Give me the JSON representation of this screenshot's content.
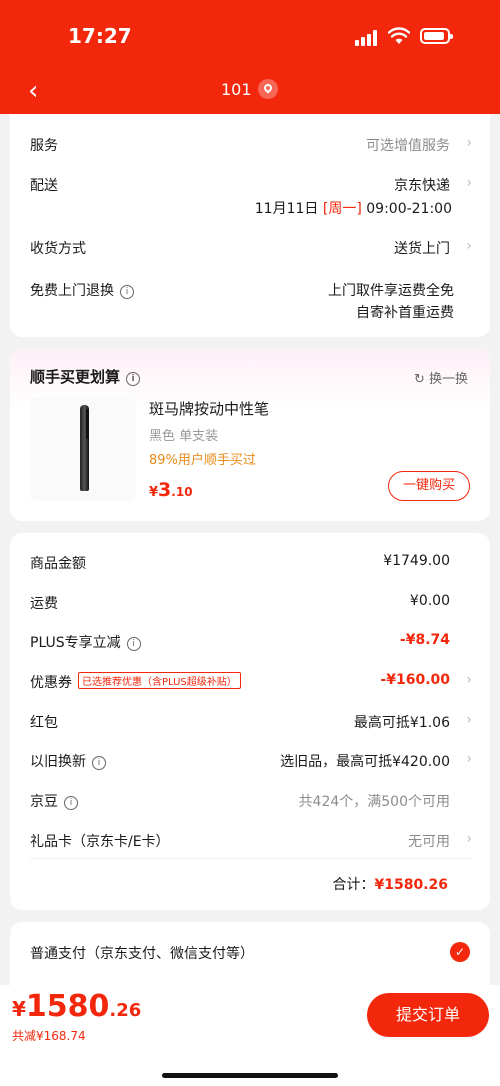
{
  "status": {
    "time": "17:27"
  },
  "nav": {
    "title": "101"
  },
  "delivery": {
    "service_label": "服务",
    "service_value": "可选增值服务",
    "ship_label": "配送",
    "ship_value": "京东快递",
    "ship_date": "11月11日",
    "ship_weekday": "[周一]",
    "ship_time": "09:00-21:00",
    "receive_label": "收货方式",
    "receive_value": "送货上门",
    "return_label": "免费上门退换",
    "return_value_1": "上门取件享运费全免",
    "return_value_2": "自寄补首重运费"
  },
  "addon": {
    "title": "顺手买更划算",
    "refresh_label": "换一换",
    "product_name": "斑马牌按动中性笔",
    "product_spec": "黑色 单支装",
    "product_promo": "89%用户顺手买过",
    "price_int": "3",
    "price_dec": ".10",
    "currency": "¥",
    "buy_label": "一键购买"
  },
  "summary": {
    "goods_label": "商品金额",
    "goods_value": "¥1749.00",
    "freight_label": "运费",
    "freight_value": "¥0.00",
    "plus_label": "PLUS专享立减",
    "plus_value": "-¥8.74",
    "coupon_label": "优惠券",
    "coupon_tag": "已选推荐优惠（含PLUS超级补贴）",
    "coupon_value": "-¥160.00",
    "redpack_label": "红包",
    "redpack_value": "最高可抵¥1.06",
    "tradein_label": "以旧换新",
    "tradein_value": "选旧品，最高可抵¥420.00",
    "bean_label": "京豆",
    "bean_value": "共424个，满500个可用",
    "giftcard_label": "礼品卡（京东卡/E卡）",
    "giftcard_value": "无可用",
    "total_label": "合计：",
    "total_value": "¥1580.26"
  },
  "payment": {
    "label": "普通支付（京东支付、微信支付等）"
  },
  "bottom": {
    "currency": "¥",
    "price_int": "1580",
    "price_dec": ".26",
    "saved": "共减¥168.74",
    "submit": "提交订单"
  },
  "colors": {
    "brand": "#f2270c",
    "bg": "#f2f2f2"
  }
}
